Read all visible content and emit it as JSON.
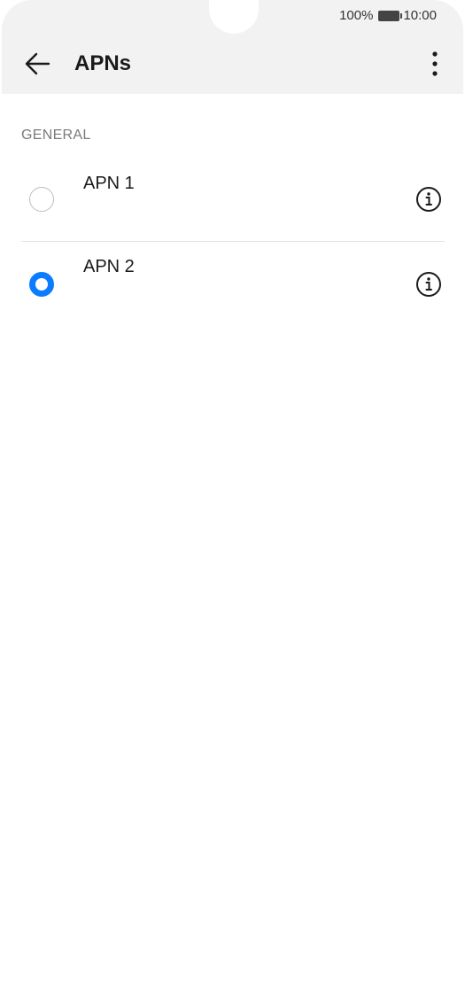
{
  "status_bar": {
    "battery_percent": "100%",
    "time": "10:00"
  },
  "header": {
    "title": "APNs",
    "back_icon": "arrow-left-icon",
    "more_icon": "more-vertical-icon"
  },
  "section": {
    "title": "GENERAL"
  },
  "apns": [
    {
      "name": "APN 1",
      "selected": false
    },
    {
      "name": "APN 2",
      "selected": true
    }
  ],
  "colors": {
    "accent": "#0a7cff",
    "header_bg": "#f2f2f2",
    "section_text": "#7a7a7a"
  }
}
